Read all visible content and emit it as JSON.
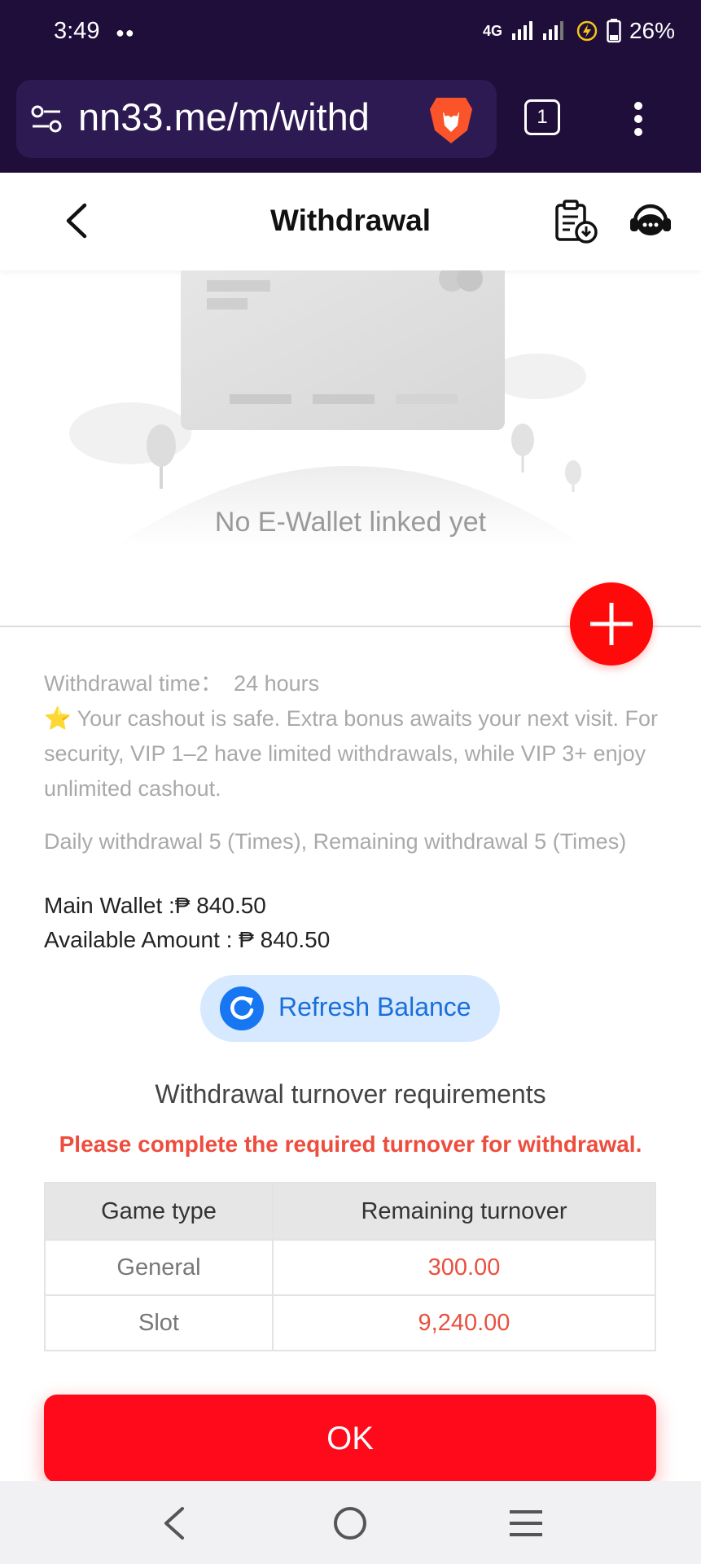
{
  "status_bar": {
    "time": "3:49",
    "network": "4G",
    "battery": "26%"
  },
  "browser": {
    "url": "nn33.me/m/withd",
    "tab_count": "1"
  },
  "header": {
    "title": "Withdrawal"
  },
  "empty_state": {
    "message": "No E-Wallet linked yet"
  },
  "info": {
    "withdrawal_time_label": "Withdrawal time：",
    "withdrawal_time_value": "24 hours",
    "notice": "⭐ Your cashout is safe. Extra bonus awaits your next visit. For security, VIP 1–2 have limited withdrawals, while VIP 3+ enjoy unlimited cashout.",
    "daily": "Daily withdrawal 5 (Times), Remaining withdrawal 5 (Times)",
    "main_wallet": "Main Wallet :₱ 840.50",
    "available_amount": "Available Amount : ₱ 840.50"
  },
  "refresh_button": {
    "label": "Refresh Balance"
  },
  "turnover": {
    "title": "Withdrawal turnover requirements",
    "warning": "Please complete the required turnover for withdrawal.",
    "columns": [
      "Game type",
      "Remaining turnover"
    ],
    "rows": [
      {
        "type": "General",
        "remaining": "300.00"
      },
      {
        "type": "Slot",
        "remaining": "9,240.00"
      }
    ]
  },
  "ok_button": {
    "label": "OK"
  },
  "colors": {
    "accent_red": "#ff0a1a",
    "browser_bar": "#1f0d3a",
    "refresh_blue": "#1777f2",
    "amount_red": "#e8513f"
  },
  "icons": [
    "settings-sliders-icon",
    "brave-lion-icon",
    "tabs-icon",
    "more-vert-icon",
    "back-arrow-icon",
    "records-download-icon",
    "customer-support-icon",
    "plus-icon",
    "refresh-icon",
    "nav-back-icon",
    "nav-home-icon",
    "nav-recents-icon"
  ]
}
